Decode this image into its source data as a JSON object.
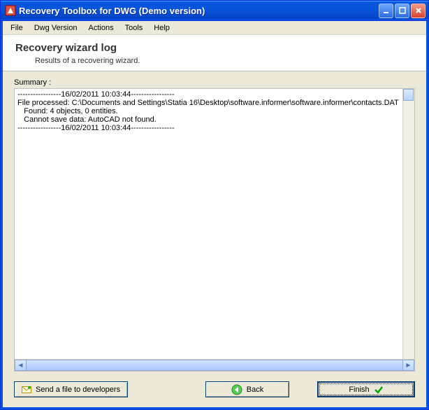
{
  "titlebar": {
    "title": "Recovery Toolbox for DWG (Demo version)"
  },
  "menubar": {
    "file": "File",
    "dwgversion": "Dwg Version",
    "actions": "Actions",
    "tools": "Tools",
    "help": "Help"
  },
  "header": {
    "title": "Recovery wizard log",
    "subtitle": "Results of a recovering wizard."
  },
  "summary_label": "Summary :",
  "log": {
    "sep_start": "-----------------16/02/2011 10:03:44-----------------",
    "line1": "File processed: C:\\Documents and Settings\\Statia 16\\Desktop\\software.informer\\software.informer\\contacts.DAT",
    "line2": "   Found: 4 objects, 0 entities.",
    "line3": "   Cannot save data: AutoCAD not found.",
    "sep_end": "-----------------16/02/2011 10:03:44-----------------"
  },
  "buttons": {
    "send": "Send a file to developers",
    "back": "Back",
    "finish": "Finish"
  }
}
